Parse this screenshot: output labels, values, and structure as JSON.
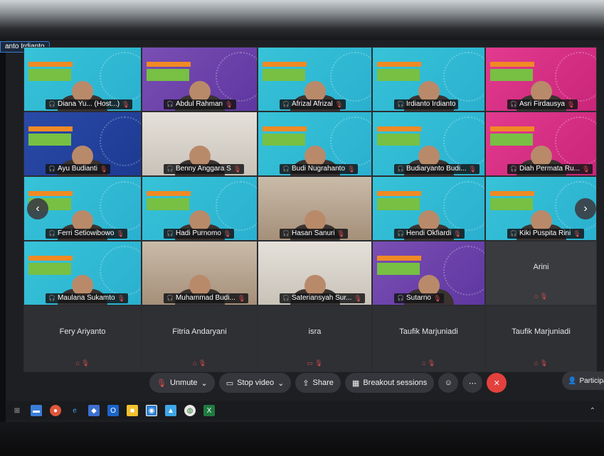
{
  "active_speaker_label": "anto Irdianto",
  "tiles": [
    {
      "name": "Diana Yu... (Host...)",
      "style": "slide",
      "mic": true
    },
    {
      "name": "Abdul Rahman",
      "style": "slide purple",
      "mic": true
    },
    {
      "name": "Afrizal Afrizal",
      "style": "slide",
      "mic": true
    },
    {
      "name": "Irdianto Irdianto",
      "style": "slide",
      "mic": false
    },
    {
      "name": "Asri Firdausya",
      "style": "slide pink",
      "mic": true
    },
    {
      "name": "Ayu Budianti",
      "style": "slide blue",
      "mic": true
    },
    {
      "name": "Benny Anggara S",
      "style": "office2",
      "mic": true
    },
    {
      "name": "Budi Nugrahanto",
      "style": "slide",
      "mic": true
    },
    {
      "name": "Budiaryanto Budi...",
      "style": "slide",
      "mic": true
    },
    {
      "name": "Diah Permata Ru...",
      "style": "slide pink",
      "mic": true
    },
    {
      "name": "Ferri Setiowibowo",
      "style": "slide",
      "mic": true
    },
    {
      "name": "Hadi Purnomo",
      "style": "slide",
      "mic": true
    },
    {
      "name": "Hasan Sanuri",
      "style": "office",
      "mic": true
    },
    {
      "name": "Hendi Okfiardi",
      "style": "slide",
      "mic": true
    },
    {
      "name": "Kiki Puspita Rini",
      "style": "slide",
      "mic": true
    },
    {
      "name": "Maulana Sukamto",
      "style": "slide",
      "mic": true
    },
    {
      "name": "Muhammad Budi...",
      "style": "office",
      "mic": true
    },
    {
      "name": "Sateriansyah Sur...",
      "style": "office2",
      "mic": true
    },
    {
      "name": "Sutarno",
      "style": "slide purple",
      "mic": true
    },
    {
      "name": "Arini",
      "style": "empty",
      "mic": true,
      "centered": true
    },
    {
      "name": "Fery Ariyanto",
      "style": "dark",
      "mic": true,
      "centered": true
    },
    {
      "name": "Fitria Andaryani",
      "style": "dark",
      "mic": true,
      "centered": true
    },
    {
      "name": "isra",
      "style": "dark",
      "mic": false,
      "centered": true
    },
    {
      "name": "Taufik Marjuniadi",
      "style": "dark",
      "mic": true,
      "centered": true
    },
    {
      "name": "Taufik Marjuniadi",
      "style": "dark",
      "mic": true,
      "centered": true
    }
  ],
  "controls": {
    "unmute": "Unmute",
    "stop_video": "Stop video",
    "share": "Share",
    "breakout": "Breakout sessions",
    "participants": "Participan"
  },
  "icons": {
    "mic_muted": "mic-muted-icon",
    "headset": "headset-icon",
    "chevron_left": "chevron-left-icon",
    "chevron_right": "chevron-right-icon"
  },
  "colors": {
    "slide_cyan": "#37c3d8",
    "slide_pink": "#e23a8f",
    "leave_red": "#e3413d",
    "muted_red": "#e64f4f"
  }
}
